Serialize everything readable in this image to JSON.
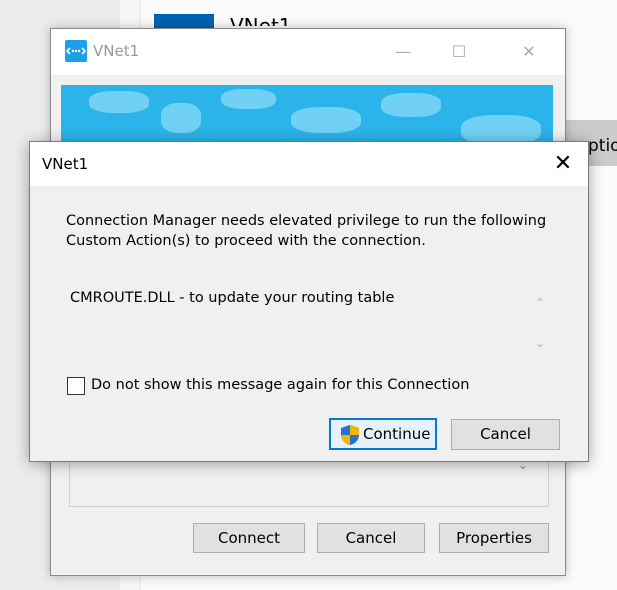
{
  "background": {
    "title_partial": "VNet1",
    "options_partial": "ptio"
  },
  "bg_window": {
    "title": "VNet1",
    "minimize_glyph": "—",
    "maximize_glyph": "☐",
    "close_glyph": "✕",
    "scroll_down_glyph": "⌄",
    "buttons": {
      "connect": "Connect",
      "cancel": "Cancel",
      "properties": "Properties"
    }
  },
  "dialog": {
    "title": "VNet1",
    "close_glyph": "✕",
    "message": "Connection Manager needs elevated privilege to run the following Custom Action(s) to proceed with the connection.",
    "action": "CMROUTE.DLL - to update your routing table",
    "scroll_up_glyph": "⌃",
    "scroll_down_glyph": "⌄",
    "checkbox_label": "Do not show this message again for this Connection",
    "checkbox_checked": false,
    "buttons": {
      "continue": "Continue",
      "cancel": "Cancel"
    }
  },
  "colors": {
    "accent": "#0078d7",
    "banner": "#2bb4ea",
    "shield_blue": "#2a6fd1",
    "shield_yellow": "#f2b705"
  }
}
